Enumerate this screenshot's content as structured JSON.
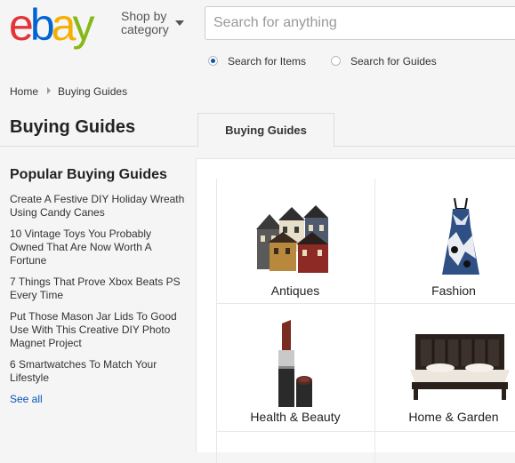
{
  "header": {
    "logo_letters": [
      {
        "char": "e",
        "color": "#e53238"
      },
      {
        "char": "b",
        "color": "#0064d2"
      },
      {
        "char": "a",
        "color": "#f5af02"
      },
      {
        "char": "y",
        "color": "#86b817"
      }
    ],
    "shop_by_line1": "Shop by",
    "shop_by_line2": "category",
    "search_placeholder": "Search for anything",
    "radio_items": "Search for Items",
    "radio_guides": "Search for Guides",
    "selected_radio": "items"
  },
  "breadcrumb": {
    "home": "Home",
    "current": "Buying Guides"
  },
  "page_title": "Buying Guides",
  "tab_label": "Buying Guides",
  "sidebar": {
    "heading": "Popular Buying Guides",
    "guides": [
      "Create A Festive DIY Holiday Wreath Using Candy Canes",
      "10 Vintage Toys You Probably Owned That Are Now Worth A Fortune",
      "7 Things That Prove Xbox Beats PS Every Time",
      "Put Those Mason Jar Lids To Good Use With This Creative DIY Photo Magnet Project",
      "6 Smartwatches To Match Your Lifestyle"
    ],
    "see_all": "See all"
  },
  "categories": [
    {
      "label": "Antiques",
      "icon": "antique-houses-icon"
    },
    {
      "label": "Fashion",
      "icon": "dress-icon"
    },
    {
      "label": "Health & Beauty",
      "icon": "lipstick-icon"
    },
    {
      "label": "Home & Garden",
      "icon": "bed-icon"
    }
  ],
  "colors": {
    "link": "#0654ba",
    "background": "#f5f5f5"
  }
}
